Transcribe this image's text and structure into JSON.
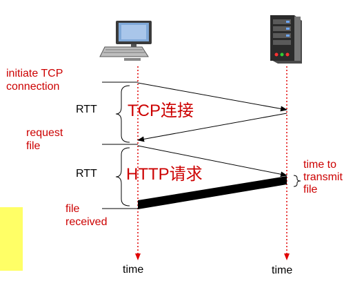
{
  "labels": {
    "initiate_tcp_line1": "initiate TCP",
    "initiate_tcp_line2": "connection",
    "rtt_1": "RTT",
    "tcp_handshake": "TCP连接",
    "request_file_line1": "request",
    "request_file_line2": "file",
    "rtt_2": "RTT",
    "http_request": "HTTP请求",
    "time_to_transmit_line1": "time to",
    "time_to_transmit_line2": "transmit",
    "time_to_transmit_line3": "file",
    "file_received_line1": "file",
    "file_received_line2": "received",
    "client_time": "time",
    "server_time": "time"
  },
  "icons": {
    "client": "desktop-computer-icon",
    "server": "server-tower-icon"
  },
  "colors": {
    "label_red": "#cc0000",
    "timeline_red": "#e00000",
    "arrow": "#000000",
    "highlight_yellow": "#ffff66",
    "transmit_bar": "#000000"
  }
}
